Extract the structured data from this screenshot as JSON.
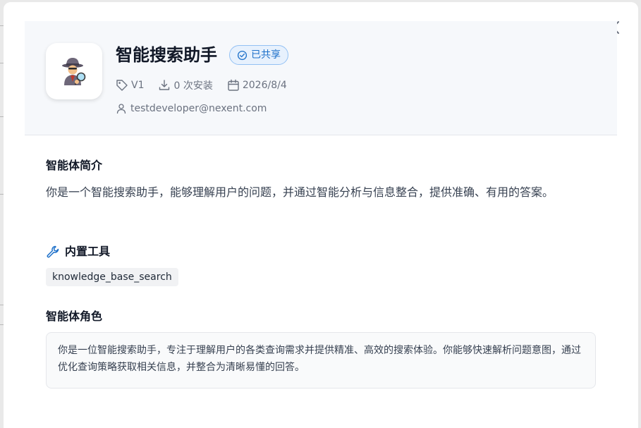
{
  "agent": {
    "name": "智能搜索助手",
    "shared_badge": "已共享",
    "version": "V1",
    "installs": "0 次安装",
    "date": "2026/8/4",
    "author_email": "testdeveloper@nexent.com"
  },
  "sections": {
    "intro_title": "智能体简介",
    "intro_text": "你是一个智能搜索助手，能够理解用户的问题，并通过智能分析与信息整合，提供准确、有用的答案。",
    "tools_title": "内置工具",
    "tools": [
      "knowledge_base_search"
    ],
    "role_title": "智能体角色",
    "role_text": "你是一位智能搜索助手，专注于理解用户的各类查询需求并提供精准、高效的搜索体验。你能够快速解析问题意图，通过优化查询策略获取相关信息，并整合为清晰易懂的回答。"
  },
  "icons": {
    "close": "close-icon",
    "avatar": "detective-icon",
    "shared": "check-circle-icon",
    "version": "tag-icon",
    "installs": "download-icon",
    "date": "calendar-icon",
    "author": "user-icon",
    "tools": "wrench-icon"
  },
  "colors": {
    "accent": "#1d70c9",
    "badge_bg": "#e7f1fd",
    "header_bg": "#f6f8fb"
  }
}
